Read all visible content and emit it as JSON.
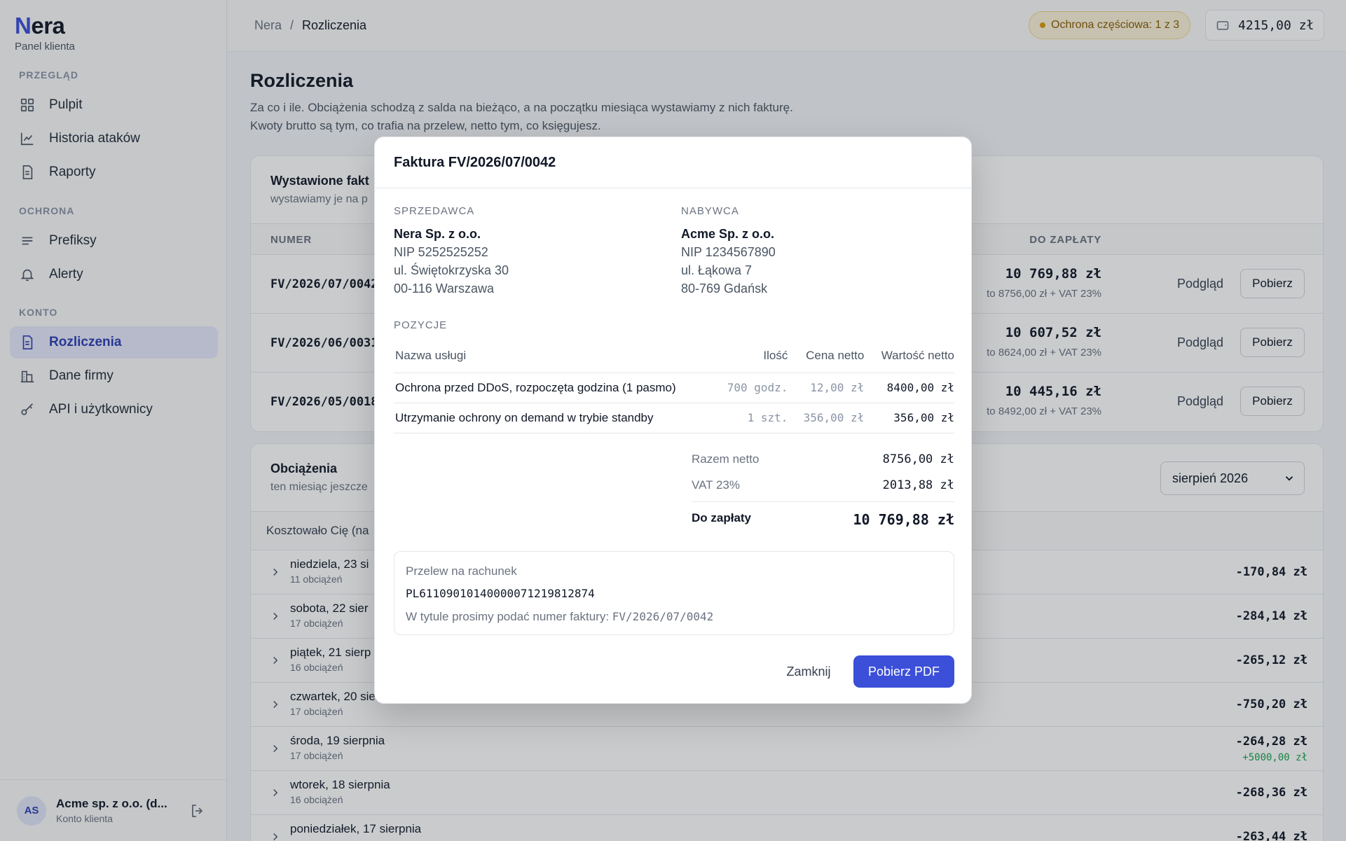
{
  "brand": {
    "logo_initial": "N",
    "logo_rest": "era",
    "subtitle": "Panel klienta"
  },
  "nav": {
    "sections": [
      {
        "label": "PRZEGLĄD",
        "items": [
          {
            "label": "Pulpit",
            "icon": "dashboard-icon"
          },
          {
            "label": "Historia ataków",
            "icon": "chart-line-icon"
          },
          {
            "label": "Raporty",
            "icon": "document-icon"
          }
        ]
      },
      {
        "label": "OCHRONA",
        "items": [
          {
            "label": "Prefiksy",
            "icon": "list-icon"
          },
          {
            "label": "Alerty",
            "icon": "bell-icon"
          }
        ]
      },
      {
        "label": "KONTO",
        "items": [
          {
            "label": "Rozliczenia",
            "icon": "invoice-icon",
            "active": true
          },
          {
            "label": "Dane firmy",
            "icon": "building-icon"
          },
          {
            "label": "API i użytkownicy",
            "icon": "key-icon"
          }
        ]
      }
    ]
  },
  "user": {
    "initials": "AS",
    "name": "Acme sp. z o.o. (d...",
    "role": "Konto klienta"
  },
  "topbar": {
    "breadcrumb": [
      "Nera",
      "Rozliczenia"
    ],
    "separator": "/",
    "protection_badge": "Ochrona częściowa: 1 z 3",
    "balance": "4215,00 zł"
  },
  "page": {
    "title": "Rozliczenia",
    "description_line1": "Za co i ile. Obciążenia schodzą z salda na bieżąco, a na początku miesiąca wystawiamy z nich fakturę.",
    "description_line2": "Kwoty brutto są tym, co trafia na przelew, netto tym, co księgujesz."
  },
  "invoices": {
    "title": "Wystawione fakt",
    "subtitle": "wystawiamy je na p",
    "col_number": "NUMER",
    "col_due": "DO ZAPŁATY",
    "rows": [
      {
        "number": "FV/2026/07/0042",
        "amount": "10 769,88 zł",
        "detail": "to 8756,00 zł + VAT 23%",
        "preview": "Podgląd",
        "download": "Pobierz"
      },
      {
        "number": "FV/2026/06/0031",
        "amount": "10 607,52 zł",
        "detail": "to 8624,00 zł + VAT 23%",
        "preview": "Podgląd",
        "download": "Pobierz"
      },
      {
        "number": "FV/2026/05/0018",
        "amount": "10 445,16 zł",
        "detail": "to 8492,00 zł + VAT 23%",
        "preview": "Podgląd",
        "download": "Pobierz"
      }
    ]
  },
  "charges": {
    "title": "Obciążenia",
    "subtitle": "ten miesiąc jeszcze",
    "month": "sierpień 2026",
    "summary": "Kosztowało Cię (na",
    "days": [
      {
        "title": "niedziela, 23 si",
        "count": "11 obciążeń",
        "amount": "-170,84 zł"
      },
      {
        "title": "sobota, 22 sier",
        "count": "17 obciążeń",
        "amount": "-284,14 zł"
      },
      {
        "title": "piątek, 21 sierp",
        "count": "16 obciążeń",
        "amount": "-265,12 zł"
      },
      {
        "title": "czwartek, 20 sierpnia",
        "count": "17 obciążeń",
        "amount": "-750,20 zł"
      },
      {
        "title": "środa, 19 sierpnia",
        "count": "17 obciążeń",
        "amount": "-264,28 zł",
        "credit": "+5000,00 zł"
      },
      {
        "title": "wtorek, 18 sierpnia",
        "count": "16 obciążeń",
        "amount": "-268,36 zł"
      },
      {
        "title": "poniedziałek, 17 sierpnia",
        "count": "",
        "amount": "-263,44 zł"
      }
    ]
  },
  "modal": {
    "title": "Faktura FV/2026/07/0042",
    "seller_label": "SPRZEDAWCA",
    "seller": {
      "name": "Nera Sp. z o.o.",
      "nip": "NIP 5252525252",
      "street": "ul. Świętokrzyska 30",
      "city": "00-116 Warszawa"
    },
    "buyer_label": "NABYWCA",
    "buyer": {
      "name": "Acme Sp. z o.o.",
      "nip": "NIP 1234567890",
      "street": "ul. Łąkowa 7",
      "city": "80-769 Gdańsk"
    },
    "items_label": "POZYCJE",
    "columns": [
      "Nazwa usługi",
      "Ilość",
      "Cena netto",
      "Wartość netto"
    ],
    "items": [
      {
        "name": "Ochrona przed DDoS, rozpoczęta godzina (1 pasmo)",
        "qty": "700 godz.",
        "price": "12,00 zł",
        "value": "8400,00 zł"
      },
      {
        "name": "Utrzymanie ochrony on demand w trybie standby",
        "qty": "1 szt.",
        "price": "356,00 zł",
        "value": "356,00 zł"
      }
    ],
    "totals": {
      "net_label": "Razem netto",
      "net": "8756,00 zł",
      "vat_label": "VAT 23%",
      "vat": "2013,88 zł",
      "due_label": "Do zapłaty",
      "due": "10 769,88 zł"
    },
    "transfer": {
      "label": "Przelew na rachunek",
      "account": "PL61109010140000071219812874",
      "note_prefix": "W tytule prosimy podać numer faktury:",
      "note_number": "FV/2026/07/0042"
    },
    "close": "Zamknij",
    "download_pdf": "Pobierz PDF"
  }
}
